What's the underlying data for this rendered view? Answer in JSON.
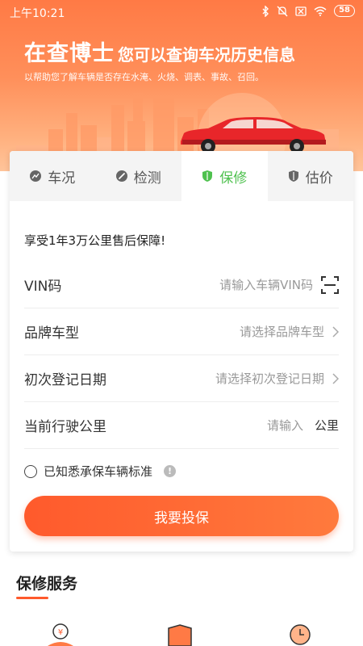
{
  "status_bar": {
    "time": "上午10:21",
    "battery": "58"
  },
  "header": {
    "brand": "在查博士",
    "tagline": "您可以查询车况历史信息",
    "subtitle": "以帮助您了解车辆是否存在水淹、火烧、调表、事故、召回。"
  },
  "tabs": [
    {
      "label": "车况",
      "icon": "chart-icon"
    },
    {
      "label": "检测",
      "icon": "wrench-icon"
    },
    {
      "label": "保修",
      "icon": "shield-icon",
      "active": true
    },
    {
      "label": "估价",
      "icon": "shield-icon"
    }
  ],
  "form": {
    "notice": "享受1年3万公里售后保障!",
    "vin": {
      "label": "VIN码",
      "placeholder": "请输入车辆VIN码"
    },
    "brand": {
      "label": "品牌车型",
      "placeholder": "请选择品牌车型"
    },
    "date": {
      "label": "初次登记日期",
      "placeholder": "请选择初次登记日期"
    },
    "mileage": {
      "label": "当前行驶公里",
      "placeholder": "请输入",
      "unit": "公里"
    },
    "agree_text": "已知悉承保车辆标准",
    "submit_label": "我要投保"
  },
  "services": {
    "title": "保修服务"
  },
  "colors": {
    "accent": "#ff5a2c",
    "active_tab": "#4ec14e",
    "banner": "#ff7a45"
  }
}
